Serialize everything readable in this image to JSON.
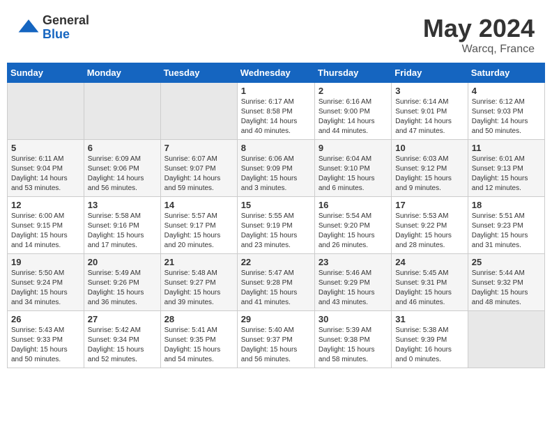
{
  "header": {
    "logo_general": "General",
    "logo_blue": "Blue",
    "month": "May 2024",
    "location": "Warcq, France"
  },
  "weekdays": [
    "Sunday",
    "Monday",
    "Tuesday",
    "Wednesday",
    "Thursday",
    "Friday",
    "Saturday"
  ],
  "weeks": [
    [
      {
        "day": "",
        "info": ""
      },
      {
        "day": "",
        "info": ""
      },
      {
        "day": "",
        "info": ""
      },
      {
        "day": "1",
        "info": "Sunrise: 6:17 AM\nSunset: 8:58 PM\nDaylight: 14 hours\nand 40 minutes."
      },
      {
        "day": "2",
        "info": "Sunrise: 6:16 AM\nSunset: 9:00 PM\nDaylight: 14 hours\nand 44 minutes."
      },
      {
        "day": "3",
        "info": "Sunrise: 6:14 AM\nSunset: 9:01 PM\nDaylight: 14 hours\nand 47 minutes."
      },
      {
        "day": "4",
        "info": "Sunrise: 6:12 AM\nSunset: 9:03 PM\nDaylight: 14 hours\nand 50 minutes."
      }
    ],
    [
      {
        "day": "5",
        "info": "Sunrise: 6:11 AM\nSunset: 9:04 PM\nDaylight: 14 hours\nand 53 minutes."
      },
      {
        "day": "6",
        "info": "Sunrise: 6:09 AM\nSunset: 9:06 PM\nDaylight: 14 hours\nand 56 minutes."
      },
      {
        "day": "7",
        "info": "Sunrise: 6:07 AM\nSunset: 9:07 PM\nDaylight: 14 hours\nand 59 minutes."
      },
      {
        "day": "8",
        "info": "Sunrise: 6:06 AM\nSunset: 9:09 PM\nDaylight: 15 hours\nand 3 minutes."
      },
      {
        "day": "9",
        "info": "Sunrise: 6:04 AM\nSunset: 9:10 PM\nDaylight: 15 hours\nand 6 minutes."
      },
      {
        "day": "10",
        "info": "Sunrise: 6:03 AM\nSunset: 9:12 PM\nDaylight: 15 hours\nand 9 minutes."
      },
      {
        "day": "11",
        "info": "Sunrise: 6:01 AM\nSunset: 9:13 PM\nDaylight: 15 hours\nand 12 minutes."
      }
    ],
    [
      {
        "day": "12",
        "info": "Sunrise: 6:00 AM\nSunset: 9:15 PM\nDaylight: 15 hours\nand 14 minutes."
      },
      {
        "day": "13",
        "info": "Sunrise: 5:58 AM\nSunset: 9:16 PM\nDaylight: 15 hours\nand 17 minutes."
      },
      {
        "day": "14",
        "info": "Sunrise: 5:57 AM\nSunset: 9:17 PM\nDaylight: 15 hours\nand 20 minutes."
      },
      {
        "day": "15",
        "info": "Sunrise: 5:55 AM\nSunset: 9:19 PM\nDaylight: 15 hours\nand 23 minutes."
      },
      {
        "day": "16",
        "info": "Sunrise: 5:54 AM\nSunset: 9:20 PM\nDaylight: 15 hours\nand 26 minutes."
      },
      {
        "day": "17",
        "info": "Sunrise: 5:53 AM\nSunset: 9:22 PM\nDaylight: 15 hours\nand 28 minutes."
      },
      {
        "day": "18",
        "info": "Sunrise: 5:51 AM\nSunset: 9:23 PM\nDaylight: 15 hours\nand 31 minutes."
      }
    ],
    [
      {
        "day": "19",
        "info": "Sunrise: 5:50 AM\nSunset: 9:24 PM\nDaylight: 15 hours\nand 34 minutes."
      },
      {
        "day": "20",
        "info": "Sunrise: 5:49 AM\nSunset: 9:26 PM\nDaylight: 15 hours\nand 36 minutes."
      },
      {
        "day": "21",
        "info": "Sunrise: 5:48 AM\nSunset: 9:27 PM\nDaylight: 15 hours\nand 39 minutes."
      },
      {
        "day": "22",
        "info": "Sunrise: 5:47 AM\nSunset: 9:28 PM\nDaylight: 15 hours\nand 41 minutes."
      },
      {
        "day": "23",
        "info": "Sunrise: 5:46 AM\nSunset: 9:29 PM\nDaylight: 15 hours\nand 43 minutes."
      },
      {
        "day": "24",
        "info": "Sunrise: 5:45 AM\nSunset: 9:31 PM\nDaylight: 15 hours\nand 46 minutes."
      },
      {
        "day": "25",
        "info": "Sunrise: 5:44 AM\nSunset: 9:32 PM\nDaylight: 15 hours\nand 48 minutes."
      }
    ],
    [
      {
        "day": "26",
        "info": "Sunrise: 5:43 AM\nSunset: 9:33 PM\nDaylight: 15 hours\nand 50 minutes."
      },
      {
        "day": "27",
        "info": "Sunrise: 5:42 AM\nSunset: 9:34 PM\nDaylight: 15 hours\nand 52 minutes."
      },
      {
        "day": "28",
        "info": "Sunrise: 5:41 AM\nSunset: 9:35 PM\nDaylight: 15 hours\nand 54 minutes."
      },
      {
        "day": "29",
        "info": "Sunrise: 5:40 AM\nSunset: 9:37 PM\nDaylight: 15 hours\nand 56 minutes."
      },
      {
        "day": "30",
        "info": "Sunrise: 5:39 AM\nSunset: 9:38 PM\nDaylight: 15 hours\nand 58 minutes."
      },
      {
        "day": "31",
        "info": "Sunrise: 5:38 AM\nSunset: 9:39 PM\nDaylight: 16 hours\nand 0 minutes."
      },
      {
        "day": "",
        "info": ""
      }
    ]
  ]
}
